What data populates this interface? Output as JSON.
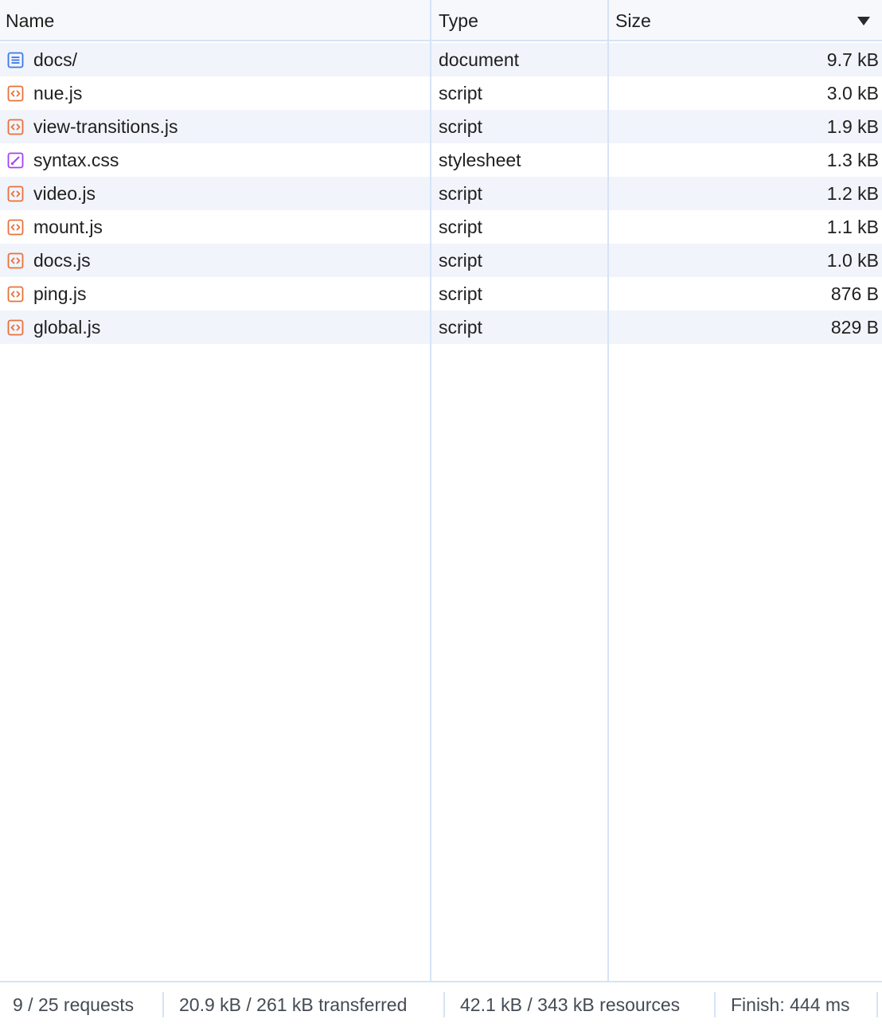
{
  "columns": {
    "name": "Name",
    "type": "Type",
    "size": "Size"
  },
  "sort": {
    "column": "Size",
    "direction": "descending",
    "icon": "sort-descending-icon"
  },
  "requests": [
    {
      "name": "docs/",
      "type": "document",
      "size": "9.7 kB",
      "icon": "document-icon",
      "icon_color": "#3b78e7"
    },
    {
      "name": "nue.js",
      "type": "script",
      "size": "3.0 kB",
      "icon": "script-icon",
      "icon_color": "#e8713b"
    },
    {
      "name": "view-transitions.js",
      "type": "script",
      "size": "1.9 kB",
      "icon": "script-icon",
      "icon_color": "#e8713b"
    },
    {
      "name": "syntax.css",
      "type": "stylesheet",
      "size": "1.3 kB",
      "icon": "stylesheet-icon",
      "icon_color": "#a142f4"
    },
    {
      "name": "video.js",
      "type": "script",
      "size": "1.2 kB",
      "icon": "script-icon",
      "icon_color": "#e8713b"
    },
    {
      "name": "mount.js",
      "type": "script",
      "size": "1.1 kB",
      "icon": "script-icon",
      "icon_color": "#e8713b"
    },
    {
      "name": "docs.js",
      "type": "script",
      "size": "1.0 kB",
      "icon": "script-icon",
      "icon_color": "#e8713b"
    },
    {
      "name": "ping.js",
      "type": "script",
      "size": "876 B",
      "icon": "script-icon",
      "icon_color": "#e8713b"
    },
    {
      "name": "global.js",
      "type": "script",
      "size": "829 B",
      "icon": "script-icon",
      "icon_color": "#e8713b"
    }
  ],
  "summary": {
    "requests": "9 / 25 requests",
    "transferred": "20.9 kB / 261 kB transferred",
    "resources": "42.1 kB / 343 kB resources",
    "finish": "Finish: 444 ms"
  },
  "colors": {
    "divider": "#d6e3f7",
    "header_bg": "#f6f8fc",
    "alt_row_bg": "#f1f4fb"
  }
}
